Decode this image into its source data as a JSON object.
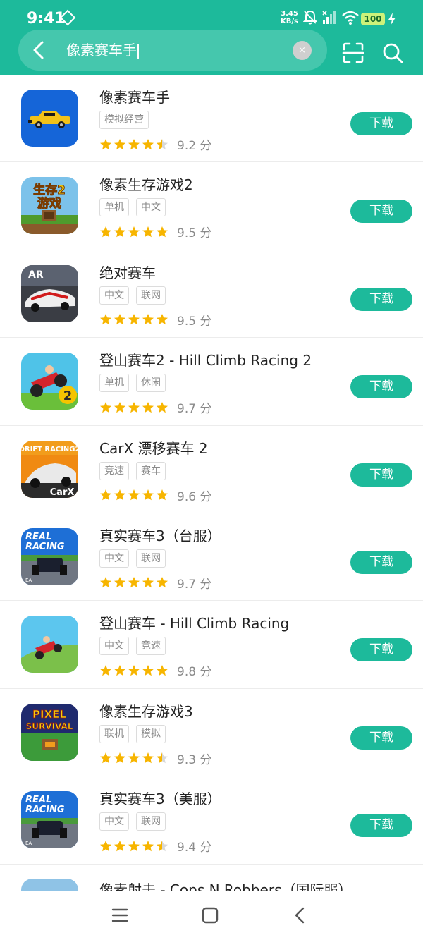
{
  "status_bar": {
    "time": "9:41",
    "net_speed_value": "3.45",
    "net_speed_unit": "KB/s",
    "battery": "100"
  },
  "search": {
    "query": "像素赛车手",
    "clear_label": "×"
  },
  "apps": [
    {
      "name": "像素赛车手",
      "tags": [
        "模拟经营"
      ],
      "rating": 4.5,
      "score": "9.2 分",
      "download_label": "下载",
      "icon": "pixel-racer-car-icon"
    },
    {
      "name": "像素生存游戏2",
      "tags": [
        "单机",
        "中文"
      ],
      "rating": 5,
      "score": "9.5 分",
      "download_label": "下载",
      "icon": "survival-game-2-icon"
    },
    {
      "name": "绝对赛车",
      "tags": [
        "中文",
        "联网"
      ],
      "rating": 5,
      "score": "9.5 分",
      "download_label": "下载",
      "icon": "asphalt-racing-icon"
    },
    {
      "name": "登山赛车2 - Hill Climb Racing 2",
      "tags": [
        "单机",
        "休闲"
      ],
      "rating": 5,
      "score": "9.7 分",
      "download_label": "下载",
      "icon": "hill-climb-2-icon"
    },
    {
      "name": "CarX 漂移赛车 2",
      "tags": [
        "竞速",
        "赛车"
      ],
      "rating": 5,
      "score": "9.6 分",
      "download_label": "下载",
      "icon": "carx-drift-icon"
    },
    {
      "name": "真实赛车3（台服）",
      "tags": [
        "中文",
        "联网"
      ],
      "rating": 5,
      "score": "9.7 分",
      "download_label": "下载",
      "icon": "real-racing-3-icon"
    },
    {
      "name": "登山赛车 - Hill Climb Racing",
      "tags": [
        "中文",
        "竞速"
      ],
      "rating": 5,
      "score": "9.8 分",
      "download_label": "下载",
      "icon": "hill-climb-icon"
    },
    {
      "name": "像素生存游戏3",
      "tags": [
        "联机",
        "模拟"
      ],
      "rating": 4.5,
      "score": "9.3 分",
      "download_label": "下载",
      "icon": "pixel-survival-3-icon"
    },
    {
      "name": "真实赛车3（美服）",
      "tags": [
        "中文",
        "联网"
      ],
      "rating": 4.5,
      "score": "9.4 分",
      "download_label": "下载",
      "icon": "real-racing-3-icon"
    }
  ],
  "partial_app": {
    "name": "像素射击 - Cops N Robbers（国际服）",
    "icon": "cops-n-robbers-icon"
  },
  "icon_texts": {
    "survival_2_top": "生存2",
    "survival_2_bottom": "游戏",
    "asphalt": "AR",
    "real_racing_line1": "REAL",
    "real_racing_line2": "RACING",
    "drift": "DRIFT RACING2",
    "carx": "CarX",
    "pixel": "PIXEL",
    "survival": "SURVIVAL",
    "ea": "EA"
  },
  "colors": {
    "accent": "#1dba9b",
    "star": "#f7b500",
    "star_empty": "#d8d8d8"
  }
}
